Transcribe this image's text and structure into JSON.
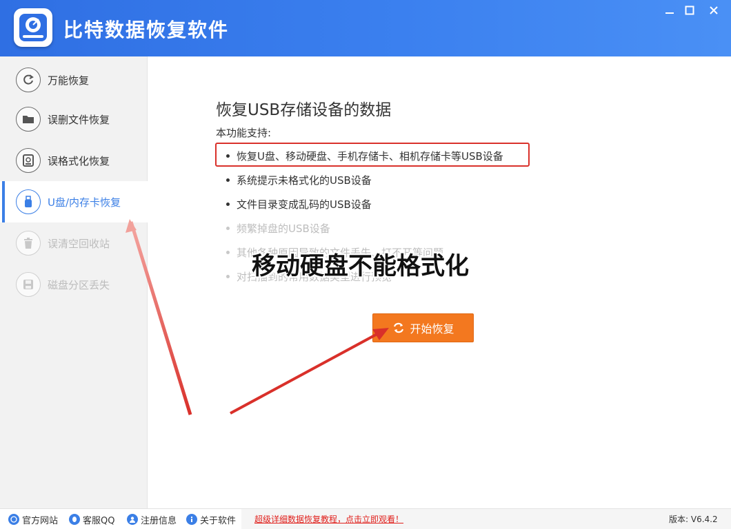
{
  "app": {
    "title": "比特数据恢复软件",
    "brand_color": "#3b80ef",
    "accent_color": "#f3781f",
    "window_controls": [
      "minimize-icon",
      "maximize-icon",
      "close-icon"
    ]
  },
  "sidebar": {
    "items": [
      {
        "label": "万能恢复",
        "icon": "refresh-icon",
        "state": "normal"
      },
      {
        "label": "误删文件恢复",
        "icon": "folder-icon",
        "state": "normal"
      },
      {
        "label": "误格式化恢复",
        "icon": "drive-icon",
        "state": "normal"
      },
      {
        "label": "U盘/内存卡恢复",
        "icon": "usb-icon",
        "state": "active"
      },
      {
        "label": "误清空回收站",
        "icon": "trash-icon",
        "state": "disabled"
      },
      {
        "label": "磁盘分区丢失",
        "icon": "disk-icon",
        "state": "disabled"
      }
    ]
  },
  "main": {
    "heading": "恢复USB存储设备的数据",
    "support_label": "本功能支持:",
    "features": [
      "恢复U盘、移动硬盘、手机存储卡、相机存储卡等USB设备",
      "系统提示未格式化的USB设备",
      "文件目录变成乱码的USB设备",
      "频繁掉盘的USB设备",
      "其他各种原因导致的文件丢失、打不开等问题",
      "对扫描到的常用数据类型进行预览"
    ],
    "overlay_caption": "移动硬盘不能格式化",
    "start_button": "开始恢复"
  },
  "statusbar": {
    "links": [
      {
        "label": "官方网站",
        "icon": "globe-icon"
      },
      {
        "label": "客服QQ",
        "icon": "qq-icon"
      },
      {
        "label": "注册信息",
        "icon": "user-icon"
      },
      {
        "label": "关于软件",
        "icon": "info-icon"
      }
    ],
    "promo": "超级详细数据恢复教程，点击立即观看！",
    "version": "版本: V6.4.2"
  }
}
